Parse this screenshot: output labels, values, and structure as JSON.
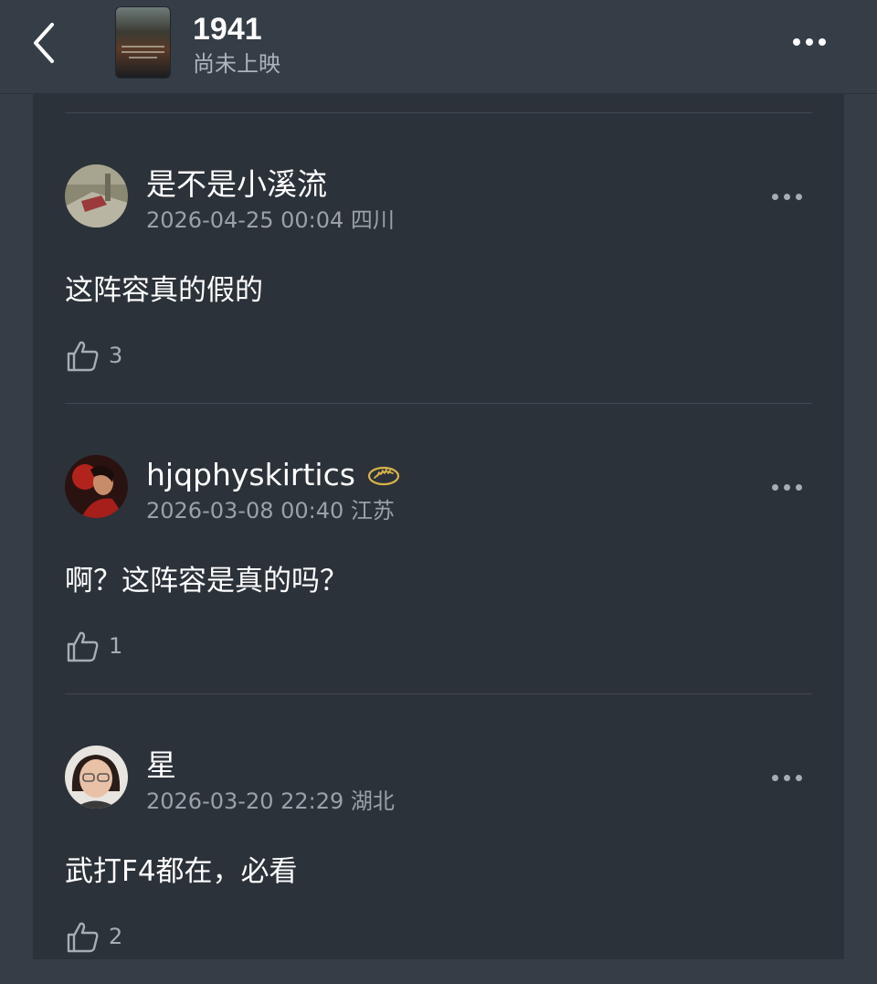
{
  "header": {
    "movie_title": "1941",
    "status": "尚未上映"
  },
  "comments": [
    {
      "username": "是不是小溪流",
      "timestamp": "2026-04-25 00:04",
      "location": "四川",
      "text": "这阵容真的假的",
      "likes": "3"
    },
    {
      "username": "hjqphyskirtics",
      "timestamp": "2026-03-08 00:40",
      "location": "江苏",
      "text": "啊？这阵容是真的吗？",
      "likes": "1",
      "badge_icon": "palm-badge-icon"
    },
    {
      "username": "星",
      "timestamp": "2026-03-20 22:29",
      "location": "湖北",
      "text": "武打F4都在，必看",
      "likes": "2"
    }
  ],
  "icons": {
    "back": "chevron-left-icon",
    "more": "more-horizontal-icon",
    "like": "thumbs-up-icon"
  },
  "colors": {
    "background": "#353d46",
    "card": "#2c3239",
    "meta_text": "#9aa1a9",
    "badge_gold": "#d8b24a"
  }
}
